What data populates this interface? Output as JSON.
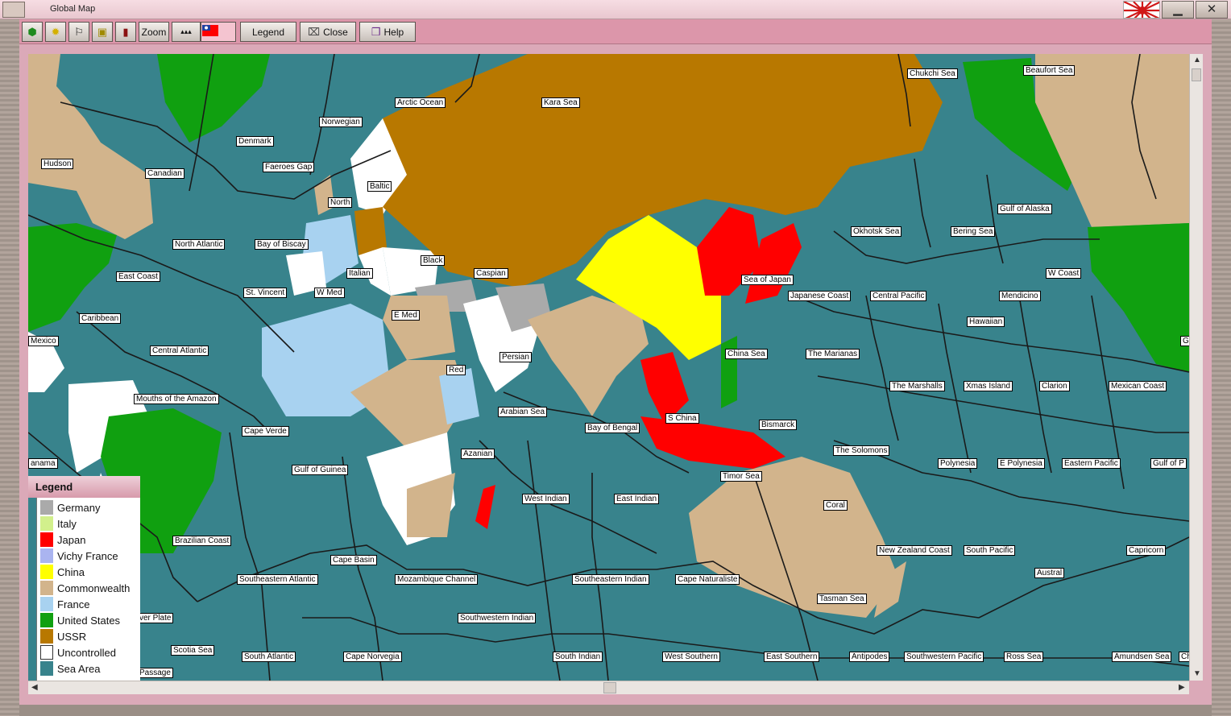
{
  "window": {
    "title": "Global Map",
    "colors": {
      "titlebar": "#f0d4dc",
      "toolbar": "#dc96aa",
      "sea": "#38838c",
      "border": "#1a1a1a"
    }
  },
  "titlebar_buttons": [
    {
      "name": "rising-sun-flag-icon",
      "glyph": ""
    },
    {
      "name": "minimize-button",
      "glyph": "▁"
    },
    {
      "name": "close-window-button",
      "glyph": "✕"
    }
  ],
  "toolbar": {
    "tools": [
      {
        "name": "supply-tool-button",
        "icon": "hexagon-icon",
        "glyph": "⬢",
        "color": "#1e8a1e",
        "label": ""
      },
      {
        "name": "weather-tool-button",
        "icon": "sun-icon",
        "glyph": "✹",
        "color": "#d4b000",
        "label": ""
      },
      {
        "name": "flag-tool-button",
        "icon": "flag-icon",
        "glyph": "⚐",
        "color": "#222",
        "label": ""
      },
      {
        "name": "city-tool-button",
        "icon": "building-icon",
        "glyph": "▣",
        "color": "#b89a00",
        "label": ""
      },
      {
        "name": "factory-tool-button",
        "icon": "chimney-icon",
        "glyph": "▮",
        "color": "#8a1010",
        "label": ""
      },
      {
        "name": "zoom-button",
        "icon": "",
        "glyph": "",
        "color": "#111",
        "label": "Zoom"
      },
      {
        "name": "terrain-tool-button",
        "icon": "mountains-icon",
        "glyph": "▴▴▴",
        "color": "#333",
        "label": ""
      },
      {
        "name": "nation-flag-button",
        "icon": "roc-flag-icon",
        "glyph": "",
        "color": "#1f3fa0",
        "label": ""
      },
      {
        "name": "legend-button",
        "icon": "",
        "glyph": "",
        "color": "#111",
        "label": "Legend"
      },
      {
        "name": "close-button",
        "icon": "close-door-icon",
        "glyph": "⌧",
        "color": "#444",
        "label": "Close"
      },
      {
        "name": "help-button",
        "icon": "book-icon",
        "glyph": "❒",
        "color": "#6a2a8a",
        "label": "Help"
      }
    ]
  },
  "legend": {
    "title": "Legend",
    "entries": [
      {
        "label": "Germany",
        "color": "#aaaaaa"
      },
      {
        "label": "Italy",
        "color": "#d2f08c"
      },
      {
        "label": "Japan",
        "color": "#ff0000"
      },
      {
        "label": "Vichy France",
        "color": "#aab4f0"
      },
      {
        "label": "China",
        "color": "#ffff00"
      },
      {
        "label": "Commonwealth",
        "color": "#d2b48c"
      },
      {
        "label": "France",
        "color": "#a8d2f0"
      },
      {
        "label": "United States",
        "color": "#10a010"
      },
      {
        "label": "USSR",
        "color": "#b87800"
      },
      {
        "label": "Uncontrolled",
        "color": "#ffffff"
      },
      {
        "label": "Sea Area",
        "color": "#38838c"
      }
    ]
  },
  "sea_areas": [
    "Arctic Ocean",
    "Kara Sea",
    "Chukchi Sea",
    "Beaufort Sea",
    "Norwegian",
    "Denmark",
    "Hudson",
    "Canadian",
    "Faeroes Gap",
    "Baltic",
    "North",
    "North Atlantic",
    "Bay of Biscay",
    "Gulf of Alaska",
    "Okhotsk Sea",
    "Bering Sea",
    "East Coast",
    "Black",
    "Italian",
    "Caspian",
    "Sea of Japan",
    "W Coast",
    "St. Vincent",
    "W Med",
    "E Med",
    "Japanese Coast",
    "Central Pacific",
    "Mendicino",
    "Caribbean",
    "Hawaiian",
    "Mexico",
    "Central Atlantic",
    "Persian",
    "China Sea",
    "The Marianas",
    "Red",
    "Mouths of the Amazon",
    "The Marshalls",
    "Xmas Island",
    "Clarion",
    "Mexican Coast",
    "Arabian Sea",
    "S China",
    "Bismarck",
    "Cape Verde",
    "Bay of Bengal",
    "Azanian",
    "The Solomons",
    "Polynesia",
    "E Polynesia",
    "Eastern Pacific",
    "Gulf of P",
    "anama",
    "Gulf of Guinea",
    "Timor Sea",
    "West Indian",
    "East Indian",
    "Coral",
    "Brazilian Coast",
    "New Zealand Coast",
    "South Pacific",
    "Capricorn",
    "Cape Basin",
    "Austral",
    "Southeastern Atlantic",
    "Mozambique Channel",
    "Southeastern Indian",
    "Cape Naturaliste",
    "Tasman Sea",
    "ver Plate",
    "Southwestern Indian",
    "Scotia Sea",
    "South Atlantic",
    "Cape Norvegia",
    "South Indian",
    "West Southern",
    "East Southern",
    "Antipodes",
    "Southwestern Pacific",
    "Ross Sea",
    "Amundsen Sea",
    "Passage",
    "G",
    "Ch"
  ]
}
